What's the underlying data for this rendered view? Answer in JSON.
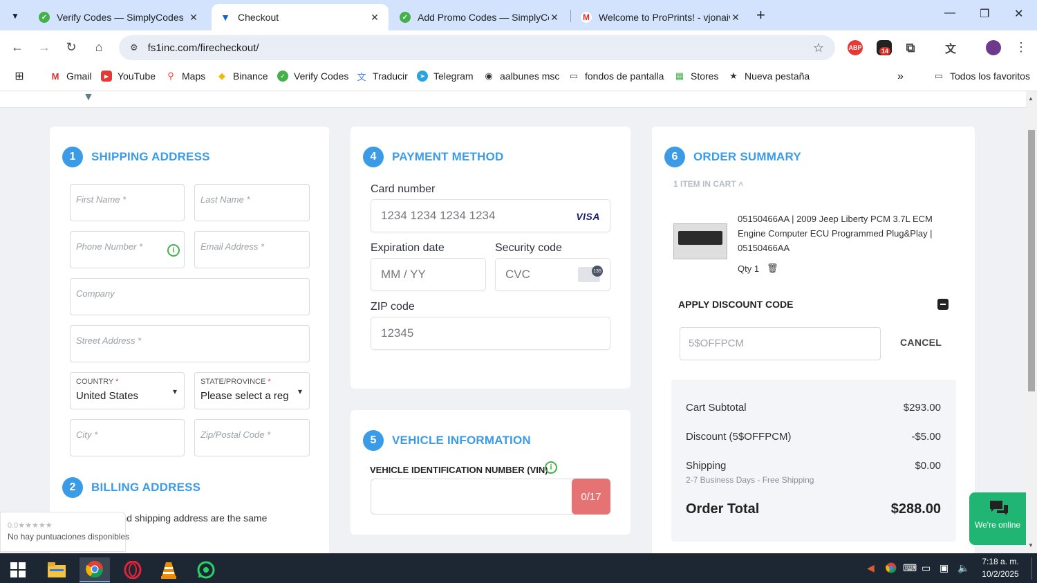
{
  "browser": {
    "tabs": [
      {
        "title": "Verify Codes — SimplyCodes",
        "active": false
      },
      {
        "title": "Checkout",
        "active": true
      },
      {
        "title": "Add Promo Codes — SimplyCo",
        "active": false
      },
      {
        "title": "Welcome to ProPrints! - vjonaiv",
        "active": false
      }
    ],
    "url": "fs1inc.com/firecheckout/",
    "extension_badge": "14",
    "bookmarks": [
      {
        "label": "Gmail",
        "icon": "gmail-icon"
      },
      {
        "label": "YouTube",
        "icon": "youtube-icon"
      },
      {
        "label": "Maps",
        "icon": "maps-icon"
      },
      {
        "label": "Binance",
        "icon": "binance-icon"
      },
      {
        "label": "Verify Codes",
        "icon": "simplycodes-icon"
      },
      {
        "label": "Traducir",
        "icon": "translate-icon"
      },
      {
        "label": "Telegram",
        "icon": "telegram-icon"
      },
      {
        "label": "aalbunes msc",
        "icon": "globe-icon"
      },
      {
        "label": "fondos de pantalla",
        "icon": "folder-icon"
      },
      {
        "label": "Stores",
        "icon": "stores-icon"
      },
      {
        "label": "Nueva pestaña",
        "icon": "star-icon"
      }
    ],
    "all_bookmarks": "Todos los favoritos"
  },
  "shipping": {
    "num": "1",
    "title": "SHIPPING ADDRESS",
    "first_name": "First Name *",
    "last_name": "Last Name *",
    "phone": "Phone Number *",
    "email": "Email Address *",
    "company": "Company",
    "street": "Street Address *",
    "country_label": "COUNTRY",
    "country_value": "United States",
    "state_label": "STATE/PROVINCE",
    "state_value": "Please select a region",
    "required_mark": "*",
    "city": "City *",
    "zip": "Zip/Postal Code *"
  },
  "billing": {
    "num": "2",
    "title": "BILLING ADDRESS",
    "same_text": "g and shipping address are the same"
  },
  "payment": {
    "num": "4",
    "title": "PAYMENT METHOD",
    "card_label": "Card number",
    "card_placeholder": "1234 1234 1234 1234",
    "card_brand": "VISA",
    "exp_label": "Expiration date",
    "exp_placeholder": "MM / YY",
    "cvc_label": "Security code",
    "cvc_placeholder": "CVC",
    "cvc_icon_text": "135",
    "zip_label": "ZIP code",
    "zip_placeholder": "12345"
  },
  "vehicle": {
    "num": "5",
    "title": "VEHICLE INFORMATION",
    "vin_label": "VEHICLE IDENTIFICATION NUMBER (VIN)",
    "vin_counter": "0/17"
  },
  "summary": {
    "num": "6",
    "title": "ORDER SUMMARY",
    "items_in_cart": "1 ITEM IN CART",
    "product_title": "05150466AA | 2009 Jeep Liberty PCM 3.7L ECM Engine Computer ECU Programmed Plug&Play | 05150466AA",
    "qty": "Qty 1",
    "discount_title": "APPLY DISCOUNT CODE",
    "discount_code": "5$OFFPCM",
    "cancel": "CANCEL",
    "subtotal_label": "Cart Subtotal",
    "subtotal_value": "$293.00",
    "discount_label": "Discount (5$OFFPCM)",
    "discount_value": "-$5.00",
    "shipping_label": "Shipping",
    "shipping_value": "$0.00",
    "shipping_note": "2-7 Business Days - Free Shipping",
    "total_label": "Order Total",
    "total_value": "$288.00"
  },
  "chat": {
    "text": "We're online"
  },
  "rating": {
    "stars": "0.0★★★★★",
    "text": "No hay puntuaciones disponibles"
  },
  "taskbar": {
    "time": "7:18 a. m.",
    "date": "10/2/2025"
  }
}
